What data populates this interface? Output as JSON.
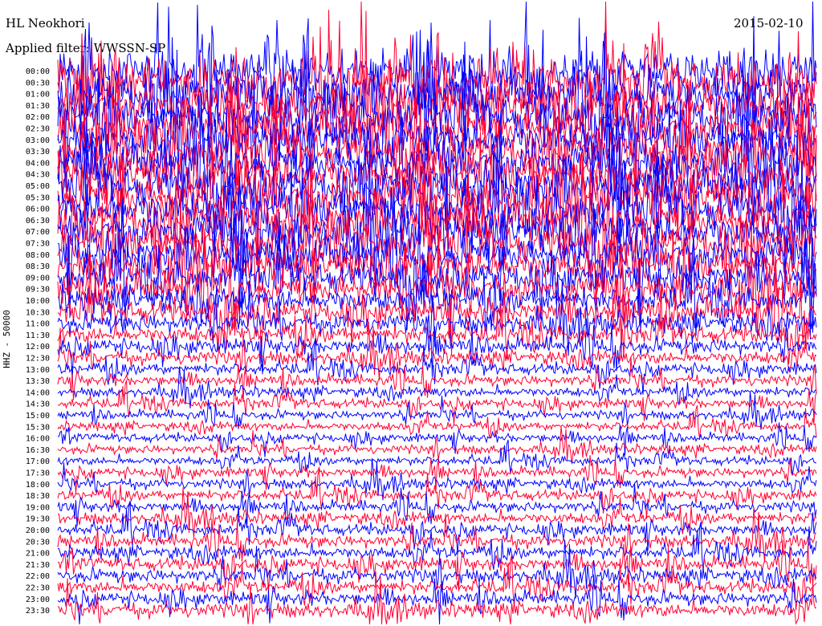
{
  "header": {
    "station": "HL Neokhori",
    "date": "2015-02-10",
    "filter": "Applied filter: WWSSN-SP"
  },
  "colors": {
    "trace_a": "#ff0033",
    "trace_b": "#0000ff",
    "background": "#ffffff",
    "text": "#000000"
  },
  "chart_data": {
    "type": "line",
    "subtype": "helicorder",
    "ylabel": "HHZ - 50000",
    "row_interval_minutes": 30,
    "rows": [
      "00:00",
      "00:30",
      "01:00",
      "01:30",
      "02:00",
      "02:30",
      "03:00",
      "03:30",
      "04:00",
      "04:30",
      "05:00",
      "05:30",
      "06:00",
      "06:30",
      "07:00",
      "07:30",
      "08:00",
      "08:30",
      "09:00",
      "09:30",
      "10:00",
      "10:30",
      "11:00",
      "11:30",
      "12:00",
      "12:30",
      "13:00",
      "13:30",
      "14:00",
      "14:30",
      "15:00",
      "15:30",
      "16:00",
      "16:30",
      "17:00",
      "17:30",
      "18:00",
      "18:30",
      "19:00",
      "19:30",
      "20:00",
      "20:30",
      "21:00",
      "21:30",
      "22:00",
      "22:30",
      "23:00",
      "23:30"
    ],
    "row_colors": [
      "trace_b",
      "trace_a"
    ],
    "series": [
      {
        "name": "HHZ",
        "relative_amplitude_by_row": [
          2.2,
          2.3,
          2.2,
          2.1,
          2.1,
          2.0,
          2.0,
          2.0,
          2.0,
          2.0,
          2.0,
          2.1,
          2.1,
          2.0,
          2.0,
          1.9,
          1.8,
          1.7,
          1.6,
          1.5,
          1.3,
          1.2,
          1.0,
          0.9,
          0.8,
          0.7,
          0.6,
          0.55,
          0.5,
          0.5,
          0.45,
          0.45,
          0.45,
          0.45,
          0.45,
          0.5,
          0.5,
          0.55,
          0.55,
          0.6,
          0.6,
          0.65,
          0.65,
          0.7,
          0.7,
          0.7,
          0.7,
          0.75
        ]
      }
    ]
  }
}
